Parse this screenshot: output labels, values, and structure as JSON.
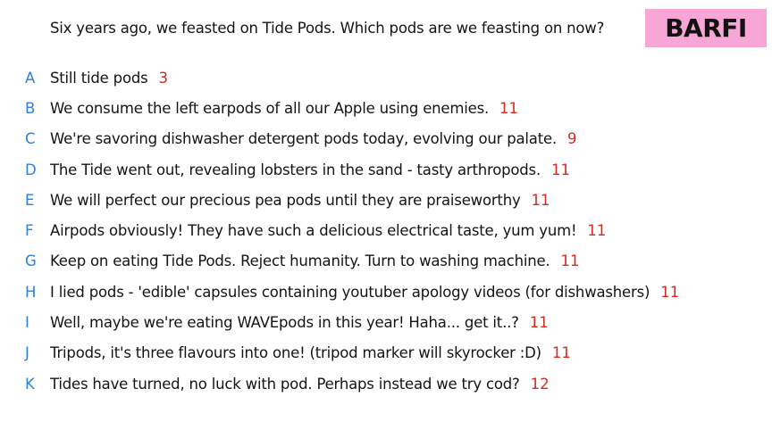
{
  "question": "Six years ago, we feasted on Tide Pods. Which pods are we feasting on now?",
  "badge": "BARFI",
  "colors": {
    "letter": "#2f80d8",
    "count": "#d62a1e",
    "badge_bg": "#f7a6d6",
    "text": "#141414"
  },
  "options": [
    {
      "letter": "A",
      "text": "Still tide pods",
      "count": "3"
    },
    {
      "letter": "B",
      "text": "We consume the left earpods of all our Apple using enemies.",
      "count": "11"
    },
    {
      "letter": "C",
      "text": "We're savoring dishwasher detergent pods today, evolving our palate.",
      "count": "9"
    },
    {
      "letter": "D",
      "text": "The Tide went out, revealing lobsters in the sand - tasty arthropods.",
      "count": "11"
    },
    {
      "letter": "E",
      "text": "We will perfect our precious pea pods until they are praiseworthy",
      "count": "11"
    },
    {
      "letter": "F",
      "text": "Airpods obviously! They have such a delicious electrical taste, yum yum!",
      "count": "11"
    },
    {
      "letter": "G",
      "text": "Keep on eating Tide Pods. Reject humanity. Turn to washing machine.",
      "count": "11"
    },
    {
      "letter": "H",
      "text": "I lied pods - 'edible' capsules containing youtuber apology videos (for dishwashers)",
      "count": "11"
    },
    {
      "letter": "I",
      "text": "Well, maybe we're eating WAVEpods in this year! Haha... get it..?",
      "count": "11"
    },
    {
      "letter": "J",
      "text": "Tripods, it's three flavours into one! (tripod marker will skyrocker :D)",
      "count": "11"
    },
    {
      "letter": "K",
      "text": "Tides have turned, no luck with pod. Perhaps instead we try cod?",
      "count": "12"
    }
  ]
}
